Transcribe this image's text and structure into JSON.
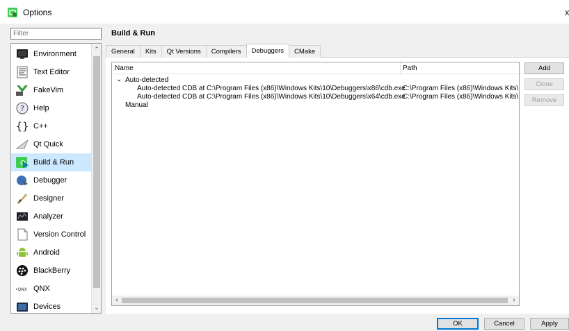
{
  "window": {
    "title": "Options",
    "close_glyph": "x",
    "app_icon": "qt-creator-icon"
  },
  "filter": {
    "placeholder": "Filter"
  },
  "sidebar": {
    "items": [
      {
        "label": "Environment",
        "icon": "monitor-icon"
      },
      {
        "label": "Text Editor",
        "icon": "text-editor-icon"
      },
      {
        "label": "FakeVim",
        "icon": "fakevim-icon"
      },
      {
        "label": "Help",
        "icon": "help-icon"
      },
      {
        "label": "C++",
        "icon": "braces-icon"
      },
      {
        "label": "Qt Quick",
        "icon": "qt-quick-icon"
      },
      {
        "label": "Build & Run",
        "icon": "build-run-icon",
        "selected": true
      },
      {
        "label": "Debugger",
        "icon": "debugger-icon"
      },
      {
        "label": "Designer",
        "icon": "designer-icon"
      },
      {
        "label": "Analyzer",
        "icon": "analyzer-icon"
      },
      {
        "label": "Version Control",
        "icon": "version-control-icon"
      },
      {
        "label": "Android",
        "icon": "android-icon"
      },
      {
        "label": "BlackBerry",
        "icon": "blackberry-icon"
      },
      {
        "label": "QNX",
        "icon": "qnx-icon"
      },
      {
        "label": "Devices",
        "icon": "devices-icon"
      }
    ]
  },
  "page": {
    "title": "Build & Run"
  },
  "tabs": [
    {
      "label": "General"
    },
    {
      "label": "Kits"
    },
    {
      "label": "Qt Versions"
    },
    {
      "label": "Compilers"
    },
    {
      "label": "Debuggers",
      "active": true
    },
    {
      "label": "CMake"
    }
  ],
  "debuggers": {
    "columns": {
      "name": "Name",
      "path": "Path"
    },
    "groups": [
      {
        "label": "Auto-detected",
        "expanded_glyph": "⌄",
        "items": [
          {
            "name": "Auto-detected CDB at C:\\Program Files (x86)\\Windows Kits\\10\\Debuggers\\x86\\cdb.exe",
            "path": "C:\\Program Files (x86)\\Windows Kits\\1"
          },
          {
            "name": "Auto-detected CDB at C:\\Program Files (x86)\\Windows Kits\\10\\Debuggers\\x64\\cdb.exe",
            "path": "C:\\Program Files (x86)\\Windows Kits\\1"
          }
        ]
      },
      {
        "label": "Manual",
        "items": []
      }
    ]
  },
  "side_buttons": {
    "add": "Add",
    "clone": "Clone",
    "remove": "Remove"
  },
  "footer": {
    "ok": "OK",
    "cancel": "Cancel",
    "apply": "Apply"
  },
  "colors": {
    "selection": "#cce8ff",
    "default_button_border": "#0078d7"
  }
}
